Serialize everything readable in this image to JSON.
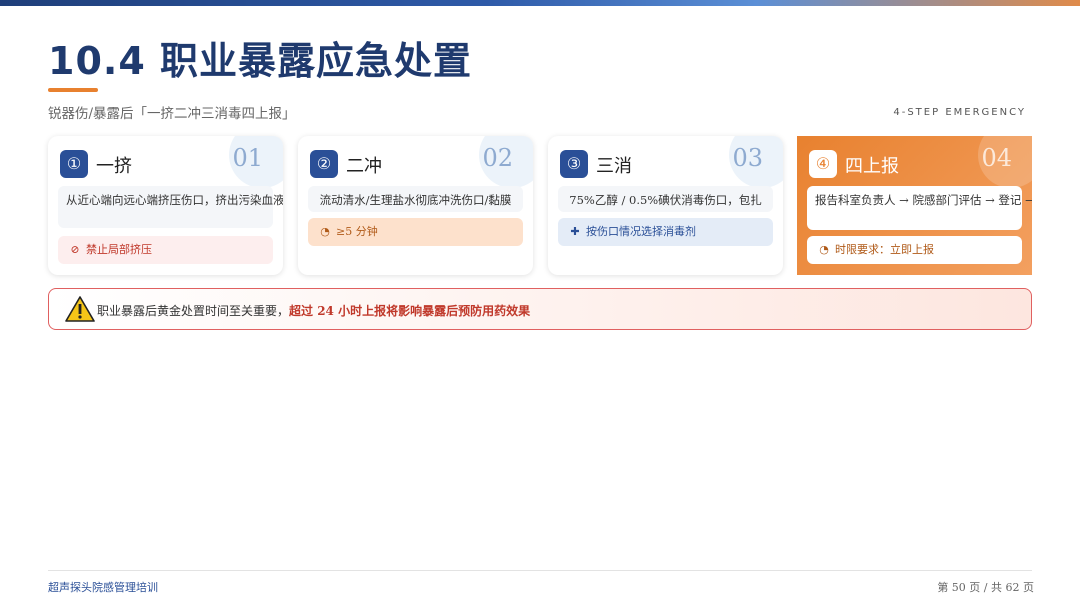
{
  "header": {
    "title": "10.4 职业暴露应急处置",
    "subtitle": "锐器伤/暴露后「一挤二冲三消毒四上报」",
    "step_tag": "4-STEP EMERGENCY"
  },
  "colors": {
    "primary": "#2a4f97",
    "accent": "#e8812f",
    "danger": "#c0392b"
  },
  "steps": [
    {
      "badge": "①",
      "number": "01",
      "title": "一挤",
      "desc": "从近心端向远心端挤压伤口，挤出污染血液",
      "tip_icon": "forbidden-icon",
      "tip_glyph": "⊘",
      "tip": "禁止局部挤压"
    },
    {
      "badge": "②",
      "number": "02",
      "title": "二冲",
      "desc": "流动清水/生理盐水彻底冲洗伤口/黏膜",
      "tip_icon": "clock-icon",
      "tip_glyph": "◔",
      "tip": "≥5 分钟"
    },
    {
      "badge": "③",
      "number": "03",
      "title": "三消",
      "desc": "75%乙醇 / 0.5%碘伏消毒伤口，包扎",
      "tip_icon": "plus-icon",
      "tip_glyph": "✚",
      "tip": "按伤口情况选择消毒剂"
    },
    {
      "badge": "④",
      "number": "04",
      "title": "四上报",
      "desc": "报告科室负责人 → 院感部门评估 → 登记 → 随访",
      "tip_icon": "clock-icon",
      "tip_glyph": "◔",
      "tip": "时限要求：立即上报"
    }
  ],
  "warning": {
    "icon": "warning-icon",
    "text": "职业暴露后黄金处置时间至关重要，",
    "highlight": "超过 24 小时上报将影响暴露后预防用药效果"
  },
  "footer": {
    "left": "超声探头院感管理培训",
    "right": "第 50 页 / 共 62 页"
  }
}
